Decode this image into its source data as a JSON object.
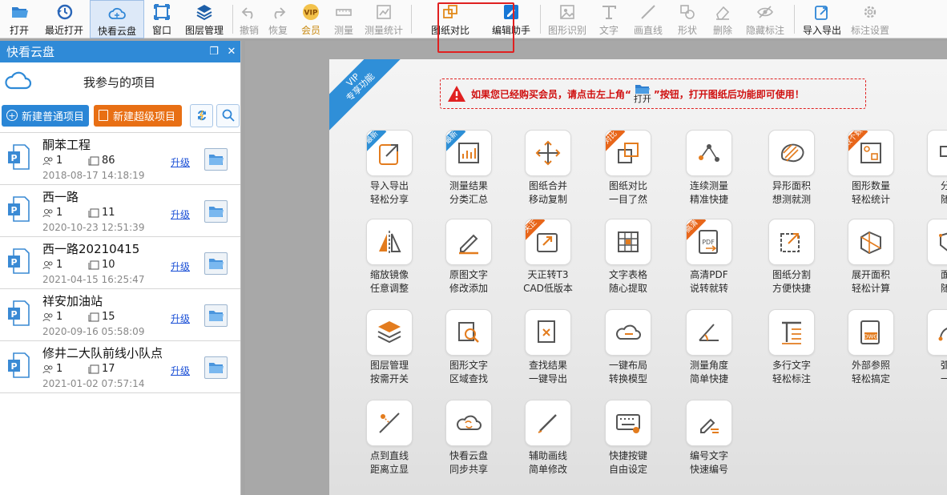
{
  "toolbar": {
    "items": [
      {
        "label": "打开",
        "icon": "open-folder-icon",
        "enabled": true
      },
      {
        "label": "最近打开",
        "icon": "history-icon",
        "enabled": true
      },
      {
        "label": "快看云盘",
        "icon": "cloud-icon",
        "enabled": true,
        "selected": true
      },
      {
        "label": "窗口",
        "icon": "window-icon",
        "enabled": true
      },
      {
        "label": "图层管理",
        "icon": "layers-icon",
        "enabled": true
      },
      {
        "label": "撤销",
        "icon": "undo-icon",
        "enabled": false
      },
      {
        "label": "恢复",
        "icon": "redo-icon",
        "enabled": false
      },
      {
        "label": "会员",
        "icon": "vip-icon",
        "enabled": true
      },
      {
        "label": "测量",
        "icon": "ruler-icon",
        "enabled": false
      },
      {
        "label": "测量统计",
        "icon": "measure-stats-icon",
        "enabled": false
      },
      {
        "label": "图纸对比",
        "icon": "compare-icon",
        "enabled": true
      },
      {
        "label": "编辑助手",
        "icon": "edit-assistant-icon",
        "enabled": true
      },
      {
        "label": "图形识别",
        "icon": "shape-recognize-icon",
        "enabled": false
      },
      {
        "label": "文字",
        "icon": "text-icon",
        "enabled": false
      },
      {
        "label": "画直线",
        "icon": "line-icon",
        "enabled": false
      },
      {
        "label": "形状",
        "icon": "shape-icon",
        "enabled": false
      },
      {
        "label": "删除",
        "icon": "eraser-icon",
        "enabled": false
      },
      {
        "label": "隐藏标注",
        "icon": "hide-icon",
        "enabled": false
      },
      {
        "label": "导入导出",
        "icon": "import-export-icon",
        "enabled": true
      },
      {
        "label": "标注设置",
        "icon": "settings-icon",
        "enabled": false
      }
    ]
  },
  "panel": {
    "title": "快看云盘",
    "section_title": "我参与的项目",
    "btn_normal": "新建普通项目",
    "btn_super": "新建超级项目",
    "upgrade_label": "升级",
    "projects": [
      {
        "name": "酮苯工程",
        "members": "1",
        "files": "86",
        "date": "2018-08-17 14:18:19"
      },
      {
        "name": "西一路",
        "members": "1",
        "files": "11",
        "date": "2020-10-23 12:51:39"
      },
      {
        "name": "西一路20210415",
        "members": "1",
        "files": "10",
        "date": "2021-04-15 16:25:47"
      },
      {
        "name": "祥安加油站",
        "members": "1",
        "files": "15",
        "date": "2020-09-16 05:58:09"
      },
      {
        "name": "修井二大队前线小队点",
        "members": "1",
        "files": "17",
        "date": "2021-01-02 07:57:14"
      }
    ]
  },
  "vip": {
    "ribbon_line1": "VIP",
    "ribbon_line2": "专享功能",
    "warning_before": "如果您已经购买会员，请点击左上角“",
    "warning_open": "打开",
    "warning_after": "”按钮，打开图纸后功能即可使用！",
    "features": [
      {
        "label": "导入导出\n轻松分享",
        "icon": "import-export-icon",
        "badge": "最新",
        "badge_color": "#2d8fd6"
      },
      {
        "label": "测量结果\n分类汇总",
        "icon": "measure-summary-icon",
        "badge": "最新",
        "badge_color": "#2d8fd6"
      },
      {
        "label": "图纸合并\n移动复制",
        "icon": "move-icon",
        "badge": "",
        "badge_color": ""
      },
      {
        "label": "图纸对比\n一目了然",
        "icon": "compare-icon",
        "badge": "对比",
        "badge_color": "#e8661a"
      },
      {
        "label": "连续测量\n精准快捷",
        "icon": "continuous-measure-icon",
        "badge": "",
        "badge_color": ""
      },
      {
        "label": "异形面积\n想测就测",
        "icon": "irregular-area-icon",
        "badge": "",
        "badge_color": ""
      },
      {
        "label": "图形数量\n轻松统计",
        "icon": "shape-count-icon",
        "badge": "数个数",
        "badge_color": "#e8661a"
      },
      {
        "label": "分解\n随心",
        "icon": "explode-icon",
        "badge": "",
        "badge_color": ""
      },
      {
        "label": "缩放镜像\n任意调整",
        "icon": "mirror-icon",
        "badge": "",
        "badge_color": ""
      },
      {
        "label": "原图文字\n修改添加",
        "icon": "pencil-icon",
        "badge": "",
        "badge_color": ""
      },
      {
        "label": "天正转T3\nCAD低版本",
        "icon": "convert-icon",
        "badge": "天正",
        "badge_color": "#e8661a"
      },
      {
        "label": "文字表格\n随心提取",
        "icon": "table-extract-icon",
        "badge": "",
        "badge_color": ""
      },
      {
        "label": "高清PDF\n说转就转",
        "icon": "pdf-icon",
        "badge": "高清",
        "badge_color": "#e8661a"
      },
      {
        "label": "图纸分割\n方便快捷",
        "icon": "split-icon",
        "badge": "",
        "badge_color": ""
      },
      {
        "label": "展开面积\n轻松计算",
        "icon": "unfold-area-icon",
        "badge": "",
        "badge_color": ""
      },
      {
        "label": "面积\n随心",
        "icon": "area-icon",
        "badge": "",
        "badge_color": ""
      },
      {
        "label": "图层管理\n按需开关",
        "icon": "layers-icon",
        "badge": "",
        "badge_color": ""
      },
      {
        "label": "图形文字\n区域查找",
        "icon": "area-search-icon",
        "badge": "",
        "badge_color": ""
      },
      {
        "label": "查找结果\n一键导出",
        "icon": "export-result-icon",
        "badge": "",
        "badge_color": ""
      },
      {
        "label": "一键布局\n转换模型",
        "icon": "layout-convert-icon",
        "badge": "",
        "badge_color": ""
      },
      {
        "label": "测量角度\n简单快捷",
        "icon": "angle-icon",
        "badge": "",
        "badge_color": ""
      },
      {
        "label": "多行文字\n轻松标注",
        "icon": "multiline-text-icon",
        "badge": "",
        "badge_color": ""
      },
      {
        "label": "外部参照\n轻松搞定",
        "icon": "xref-icon",
        "badge": "",
        "badge_color": ""
      },
      {
        "label": "弧长\n一点",
        "icon": "arc-length-icon",
        "badge": "",
        "badge_color": ""
      },
      {
        "label": "点到直线\n距离立显",
        "icon": "point-line-icon",
        "badge": "",
        "badge_color": ""
      },
      {
        "label": "快看云盘\n同步共享",
        "icon": "cloud-sync-icon",
        "badge": "",
        "badge_color": ""
      },
      {
        "label": "辅助画线\n简单修改",
        "icon": "aux-line-icon",
        "badge": "",
        "badge_color": ""
      },
      {
        "label": "快捷按键\n自由设定",
        "icon": "keyboard-icon",
        "badge": "",
        "badge_color": ""
      },
      {
        "label": "编号文字\n快速编号",
        "icon": "numbering-icon",
        "badge": "",
        "badge_color": ""
      }
    ]
  }
}
